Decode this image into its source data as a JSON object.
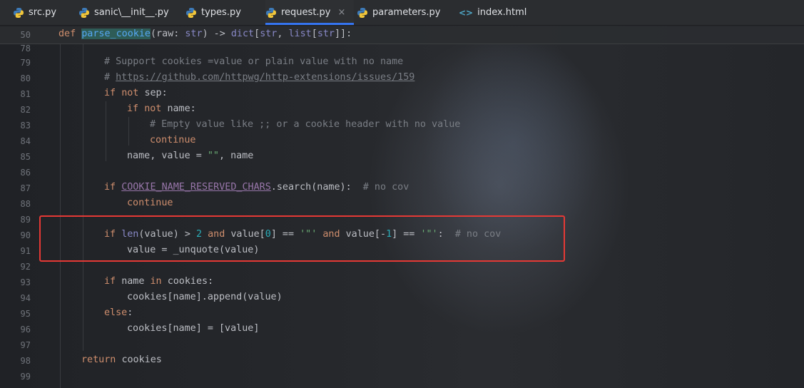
{
  "tabs": [
    {
      "label": "src.py",
      "icon": "python-icon",
      "active": false
    },
    {
      "label": "sanic\\__init__.py",
      "icon": "python-icon",
      "active": false
    },
    {
      "label": "types.py",
      "icon": "python-icon",
      "active": false
    },
    {
      "label": "request.py",
      "icon": "python-icon",
      "active": true,
      "close": "×"
    },
    {
      "label": "parameters.py",
      "icon": "python-icon",
      "active": false
    },
    {
      "label": "index.html",
      "icon": "html-icon",
      "active": false
    }
  ],
  "sticky": {
    "line_number": "50"
  },
  "line_numbers": [
    "78",
    "79",
    "80",
    "81",
    "82",
    "83",
    "84",
    "85",
    "86",
    "87",
    "88",
    "89",
    "90",
    "91",
    "92",
    "93",
    "94",
    "95",
    "96",
    "97",
    "98",
    "99"
  ],
  "code": {
    "l50_def": "def ",
    "l50_fn": "parse_cookie",
    "l50_sig1": "(raw: ",
    "l50_str1": "str",
    "l50_sig2": ") -> ",
    "l50_dict": "dict",
    "l50_sig3": "[",
    "l50_str2": "str",
    "l50_sig4": ", ",
    "l50_list": "list",
    "l50_sig5": "[",
    "l50_str3": "str",
    "l50_sig6": "]]:",
    "l79": "# Support cookies =value or plain value with no name",
    "l80_hash": "# ",
    "l80_url": "https://github.com/httpwg/http-extensions/issues/159",
    "l81_if": "if ",
    "l81_not": "not ",
    "l81_rest": "sep:",
    "l82_if": "if ",
    "l82_not": "not ",
    "l82_rest": "name:",
    "l83": "# Empty value like ;; or a cookie header with no value",
    "l84": "continue",
    "l85_a": "name, value = ",
    "l85_s": "\"\"",
    "l85_b": ", name",
    "l87_if": "if ",
    "l87_const": "COOKIE_NAME_RESERVED_CHARS",
    "l87_rest": ".search(name):  ",
    "l87_cm": "# no cov",
    "l88": "continue",
    "l90_if": "if ",
    "l90_len": "len",
    "l90_a": "(value) > ",
    "l90_n1": "2",
    "l90_and1": " and ",
    "l90_b": "value[",
    "l90_n2": "0",
    "l90_c": "] == ",
    "l90_s1": "'\"'",
    "l90_and2": " and ",
    "l90_d": "value[-",
    "l90_n3": "1",
    "l90_e": "] == ",
    "l90_s2": "'\"'",
    "l90_f": ":  ",
    "l90_cm": "# no cov",
    "l91": "value = _unquote(value)",
    "l93_if": "if ",
    "l93_a": "name ",
    "l93_in": "in ",
    "l93_b": "cookies:",
    "l94": "cookies[name].append(value)",
    "l95_else": "else",
    "l95_colon": ":",
    "l96": "cookies[name] = [value]",
    "l98_ret": "return ",
    "l98_rest": "cookies"
  },
  "colors": {
    "annotation_box": "#e53935",
    "active_tab_underline": "#3574f0"
  }
}
